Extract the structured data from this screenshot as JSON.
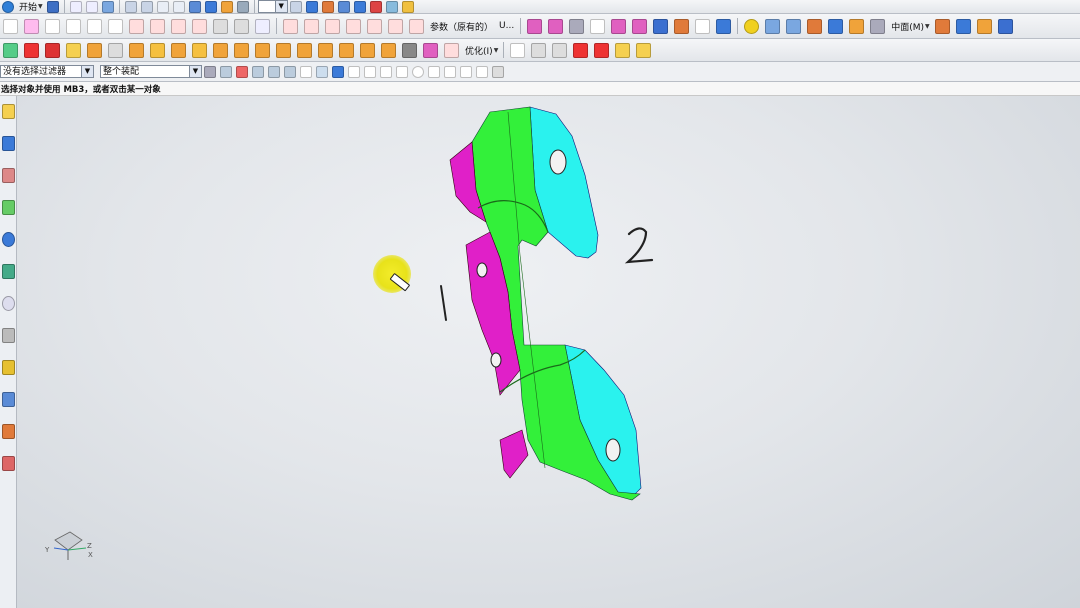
{
  "app": {
    "start_menu": "开始"
  },
  "toolbar2": {
    "params_label": "参数（原有的）",
    "params_suffix": "U..."
  },
  "toolbar2_right": {
    "section_label": "中面(M)"
  },
  "toolbar3": {
    "optimize_label": "优化(I)"
  },
  "selection_bar": {
    "filter_value": "没有选择过滤器",
    "scope_value": "整个装配"
  },
  "status": {
    "prompt": "选择对象并使用 MB3，或者双击某一对象"
  },
  "viewport": {
    "annotation_1": "1",
    "annotation_2": "2",
    "triad_x": "X",
    "triad_y": "Y",
    "triad_z": "Z"
  },
  "colors": {
    "face_magenta": "#e020c8",
    "face_green": "#33f03a",
    "face_cyan": "#2af2ee",
    "highlight": "#f3ec2a"
  }
}
